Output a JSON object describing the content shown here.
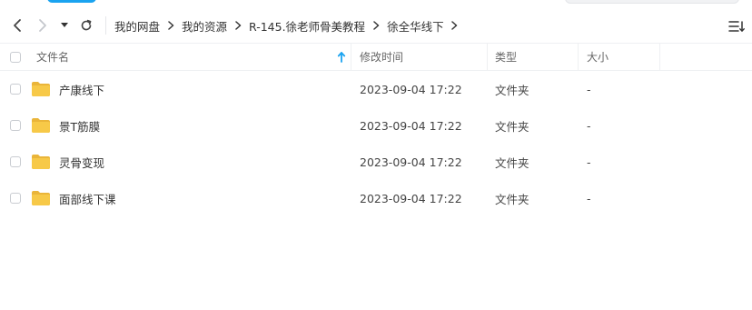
{
  "toolbar": {
    "history_icon": "caret-down-icon",
    "refresh_icon": "refresh-icon",
    "view_icon": "list-view-icon"
  },
  "breadcrumb": [
    {
      "label": "我的网盘"
    },
    {
      "label": "我的资源"
    },
    {
      "label": "R-145.徐老师骨美教程"
    },
    {
      "label": "徐全华线下"
    }
  ],
  "columns": {
    "name": "文件名",
    "date": "修改时间",
    "type": "类型",
    "size": "大小"
  },
  "rows": [
    {
      "name": "产康线下",
      "date": "2023-09-04 17:22",
      "type": "文件夹",
      "size": "-"
    },
    {
      "name": "景T筋膜",
      "date": "2023-09-04 17:22",
      "type": "文件夹",
      "size": "-"
    },
    {
      "name": "灵骨变现",
      "date": "2023-09-04 17:22",
      "type": "文件夹",
      "size": "-"
    },
    {
      "name": "面部线下课",
      "date": "2023-09-04 17:22",
      "type": "文件夹",
      "size": "-"
    }
  ],
  "colors": {
    "accent": "#1aa3f0",
    "folder": "#f7c948",
    "folder_dark": "#eab53a"
  }
}
